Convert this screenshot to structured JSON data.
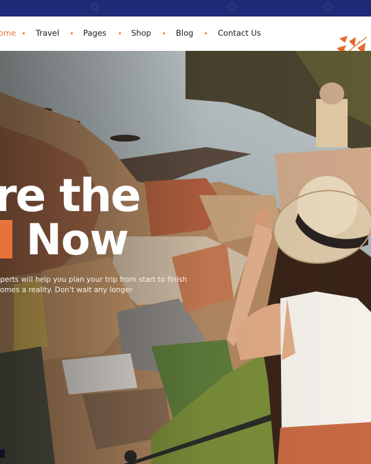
{
  "nav": {
    "items": [
      {
        "label": "ome",
        "active": true
      },
      {
        "label": "Travel",
        "active": false
      },
      {
        "label": "Pages",
        "active": false
      },
      {
        "label": "Shop",
        "active": false
      },
      {
        "label": "Blog",
        "active": false
      },
      {
        "label": "Contact Us",
        "active": false
      }
    ],
    "accent_color": "#e8733a"
  },
  "topbar": {
    "color": "#1e2b78"
  },
  "hero": {
    "title_line1": "re the",
    "title_line2": "Now",
    "description_line1": "xperts will help you plan your trip from start to finish",
    "description_line2": "comes a reality. Don't wait any longer"
  }
}
